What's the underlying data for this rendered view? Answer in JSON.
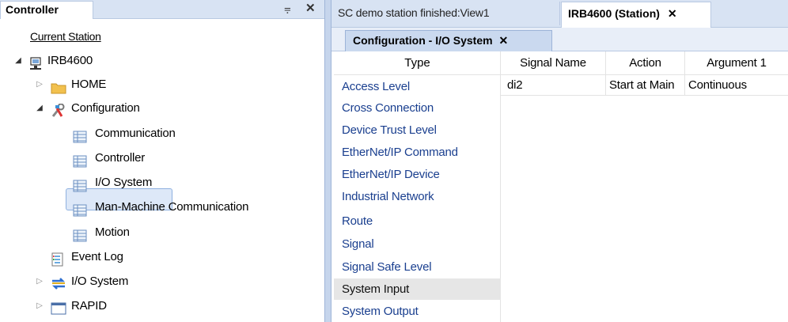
{
  "left_panel": {
    "title": "Controller",
    "pin_glyph": "⩦",
    "close_glyph": "✕",
    "current_station": "Current Station",
    "tree": {
      "root": "IRB4600",
      "home": "HOME",
      "configuration": "Configuration",
      "config_children": [
        "Communication",
        "Controller",
        "I/O System",
        "Man-Machine Communication",
        "Motion"
      ],
      "event_log": "Event Log",
      "io_system": "I/O System",
      "rapid": "RAPID"
    }
  },
  "document_tabs": {
    "tab1": "SC demo station finished:View1",
    "tab2": "IRB4600 (Station)",
    "close_glyph": "✕"
  },
  "sub_tab": {
    "label": "Configuration - I/O System",
    "close_glyph": "✕"
  },
  "type_list": {
    "header": "Type",
    "items": [
      "Access Level",
      "Cross Connection",
      "Device Trust Level",
      "EtherNet/IP Command",
      "EtherNet/IP Device",
      "Industrial Network",
      "Route",
      "Signal",
      "Signal Safe Level",
      "System Input",
      "System Output"
    ],
    "selected": "System Input"
  },
  "signal_table": {
    "columns": [
      "Signal Name",
      "Action",
      "Argument 1"
    ],
    "rows": [
      [
        "di2",
        "Start at Main",
        "Continuous"
      ]
    ]
  },
  "colors": {
    "header_bg": "#d8e3f3",
    "selection_bg": "#dde8f8",
    "link_text": "#1a3f8f"
  }
}
